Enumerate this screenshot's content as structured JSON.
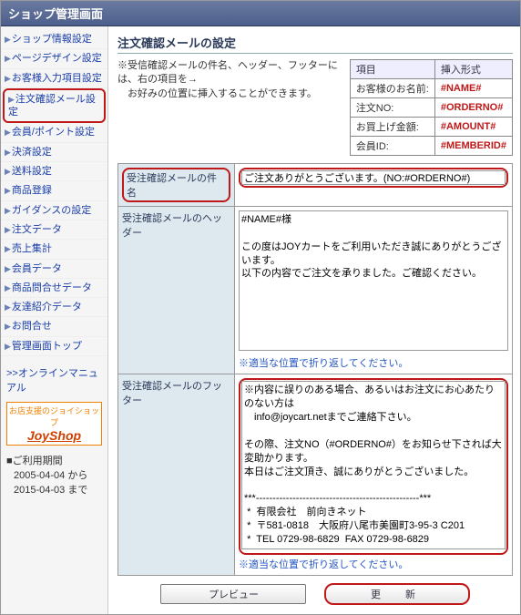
{
  "title": "ショップ管理画面",
  "nav": [
    "ショップ情報設定",
    "ページデザイン設定",
    "お客様入力項目設定",
    "注文確認メール設定",
    "会員/ポイント設定",
    "決済設定",
    "送料設定",
    "商品登録",
    "ガイダンスの設定",
    "注文データ",
    "売上集計",
    "会員データ",
    "商品問合せデータ",
    "友達紹介データ",
    "お問合せ",
    "管理画面トップ"
  ],
  "nav_selected_index": 3,
  "manual_link": ">>オンラインマニュアル",
  "logo": {
    "top": "お店支援のジョイショップ",
    "name": "JoyShop"
  },
  "period": {
    "label": "■ご利用期間",
    "from": "2005-04-04 から",
    "to": "2015-04-03 まで"
  },
  "page_heading": "注文確認メールの設定",
  "note": "※受信確認メールの件名、ヘッダー、フッターには、右の項目を→\n　お好みの位置に挿入することができます。",
  "const_table": {
    "headers": [
      "項目",
      "挿入形式"
    ],
    "rows": [
      [
        "お客様のお名前:",
        "#NAME#"
      ],
      [
        "注文NO:",
        "#ORDERNO#"
      ],
      [
        "お買上げ金額:",
        "#AMOUNT#"
      ],
      [
        "会員ID:",
        "#MEMBERID#"
      ]
    ]
  },
  "form": {
    "subject": {
      "label": "受注確認メールの件名",
      "value": "ご注文ありがとうございます。(NO:#ORDERNO#)"
    },
    "header": {
      "label": "受注確認メールのヘッダー",
      "value": "#NAME#様\n\nこの度はJOYカートをご利用いただき誠にありがとうございます。\n以下の内容でご注文を承りました。ご確認ください。",
      "note": "※適当な位置で折り返してください。"
    },
    "footer": {
      "label": "受注確認メールのフッター",
      "value": "※内容に誤りのある場合、あるいはお注文にお心あたりのない方は\n　info@joycart.netまでご連絡下さい。\n\nその際、注文NO（#ORDERNO#）をお知らせ下されば大変助かります。\n本日はご注文頂き、誠にありがとうございました。\n\n***-------------------------------------------------***\n *  有限会社　前向きネット\n *  〒581-0818　大阪府八尾市美園町3-95-3 C201\n *  TEL 0729-98-6829  FAX 0729-98-6829\n *  URL: http://www.maemuki.net/work/\n *  E-mail: info@maemuki.net\n***-------------------------------------------------***",
      "note": "※適当な位置で折り返してください。"
    }
  },
  "buttons": {
    "preview": "プレビュー",
    "update": "更　新"
  }
}
